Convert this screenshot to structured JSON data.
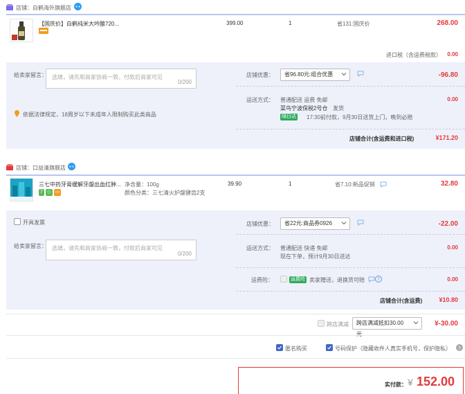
{
  "store1": {
    "label": "店铺：白鹤海外旗舰店",
    "product": {
      "title": "【国庆价】白鹤纯米大吟酿720...",
      "price": "399.00",
      "qty": "1",
      "promo": "省131:国庆价",
      "subtotal": "268.00"
    },
    "import_tax_label": "进口税（含运费税款）",
    "import_tax_value": "0.00",
    "message": {
      "label": "给卖家留言：",
      "placeholder": "选填，请先和商家协商一致，付款后商家可见",
      "count": "0/200"
    },
    "discount": {
      "label": "店铺优惠：",
      "selected": "省96.80元:组合优惠",
      "value": "-96.80"
    },
    "shipping": {
      "label": "运送方式：",
      "line1": "普通配送 运费 免邮",
      "warehouse": "菜鸟宁波保税2号仓",
      "ship_text": "发货",
      "tag": "隔日达",
      "delivery": "17:30前付款，9月30日送货上门，晚到必赔",
      "value": "0.00"
    },
    "legal": "依据法律规定，18周岁以下未成年人限制购买此类商品",
    "total_label": "店铺合计(含运费和进口税)",
    "total_value": "¥171.20"
  },
  "store2": {
    "label": "店铺：口益清旗舰店",
    "product": {
      "title": "三七中药牙膏缓解牙龈出血红肿...",
      "spec1": "净含量：100g",
      "spec2": "颜色分类：三七清火护龈健齿2支",
      "price": "39.90",
      "qty": "1",
      "promo": "省7.10:新品促销",
      "subtotal": "32.80"
    },
    "invoice_label": "开具发票",
    "message": {
      "label": "给卖家留言：",
      "placeholder": "选填，请先和商家协商一致，付款后商家可见",
      "count": "0/200"
    },
    "discount": {
      "label": "店铺优惠：",
      "selected": "省22元:商品券0926",
      "value": "-22.00"
    },
    "shipping": {
      "label": "运送方式：",
      "line1": "普通配送 快递 免邮",
      "line2": "现在下单，预计9月30日送达",
      "value": "0.00"
    },
    "insurance": {
      "label": "运费险：",
      "tag": "运费险",
      "text": "卖家赠送，退换货可赔",
      "value": "0.00"
    },
    "total_label": "店铺合计(含运费)",
    "total_value": "¥10.80"
  },
  "cross_store": {
    "label": "跨店满减",
    "selected": "跨店满减抵扣30.00元",
    "value": "¥-30.00"
  },
  "options": {
    "anonymous": "匿名购买",
    "privacy": "号码保护（隐藏收件人真实手机号，保护隐私）"
  },
  "payment": {
    "label": "实付款：",
    "symbol": "¥",
    "amount": "152.00"
  },
  "colors": {
    "accent": "#e4393c",
    "panel": "#eef1fa",
    "brand_blue": "#3f65c8"
  }
}
